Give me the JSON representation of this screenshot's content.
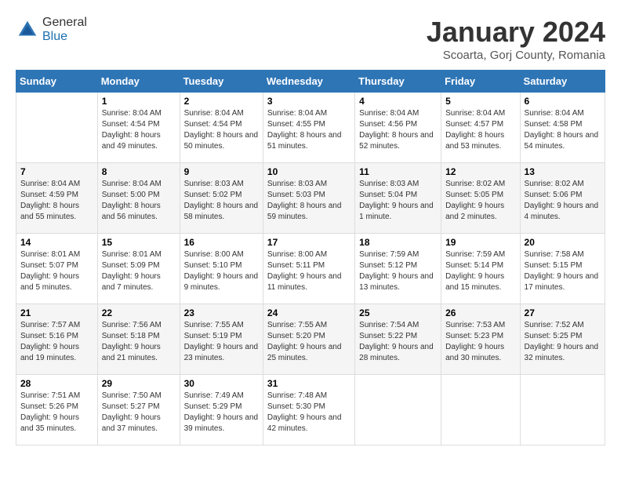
{
  "header": {
    "logo_general": "General",
    "logo_blue": "Blue",
    "month_title": "January 2024",
    "location": "Scoarta, Gorj County, Romania"
  },
  "days_of_week": [
    "Sunday",
    "Monday",
    "Tuesday",
    "Wednesday",
    "Thursday",
    "Friday",
    "Saturday"
  ],
  "weeks": [
    [
      {
        "day": "",
        "sunrise": "",
        "sunset": "",
        "daylight": ""
      },
      {
        "day": "1",
        "sunrise": "Sunrise: 8:04 AM",
        "sunset": "Sunset: 4:54 PM",
        "daylight": "Daylight: 8 hours and 49 minutes."
      },
      {
        "day": "2",
        "sunrise": "Sunrise: 8:04 AM",
        "sunset": "Sunset: 4:54 PM",
        "daylight": "Daylight: 8 hours and 50 minutes."
      },
      {
        "day": "3",
        "sunrise": "Sunrise: 8:04 AM",
        "sunset": "Sunset: 4:55 PM",
        "daylight": "Daylight: 8 hours and 51 minutes."
      },
      {
        "day": "4",
        "sunrise": "Sunrise: 8:04 AM",
        "sunset": "Sunset: 4:56 PM",
        "daylight": "Daylight: 8 hours and 52 minutes."
      },
      {
        "day": "5",
        "sunrise": "Sunrise: 8:04 AM",
        "sunset": "Sunset: 4:57 PM",
        "daylight": "Daylight: 8 hours and 53 minutes."
      },
      {
        "day": "6",
        "sunrise": "Sunrise: 8:04 AM",
        "sunset": "Sunset: 4:58 PM",
        "daylight": "Daylight: 8 hours and 54 minutes."
      }
    ],
    [
      {
        "day": "7",
        "sunrise": "Sunrise: 8:04 AM",
        "sunset": "Sunset: 4:59 PM",
        "daylight": "Daylight: 8 hours and 55 minutes."
      },
      {
        "day": "8",
        "sunrise": "Sunrise: 8:04 AM",
        "sunset": "Sunset: 5:00 PM",
        "daylight": "Daylight: 8 hours and 56 minutes."
      },
      {
        "day": "9",
        "sunrise": "Sunrise: 8:03 AM",
        "sunset": "Sunset: 5:02 PM",
        "daylight": "Daylight: 8 hours and 58 minutes."
      },
      {
        "day": "10",
        "sunrise": "Sunrise: 8:03 AM",
        "sunset": "Sunset: 5:03 PM",
        "daylight": "Daylight: 8 hours and 59 minutes."
      },
      {
        "day": "11",
        "sunrise": "Sunrise: 8:03 AM",
        "sunset": "Sunset: 5:04 PM",
        "daylight": "Daylight: 9 hours and 1 minute."
      },
      {
        "day": "12",
        "sunrise": "Sunrise: 8:02 AM",
        "sunset": "Sunset: 5:05 PM",
        "daylight": "Daylight: 9 hours and 2 minutes."
      },
      {
        "day": "13",
        "sunrise": "Sunrise: 8:02 AM",
        "sunset": "Sunset: 5:06 PM",
        "daylight": "Daylight: 9 hours and 4 minutes."
      }
    ],
    [
      {
        "day": "14",
        "sunrise": "Sunrise: 8:01 AM",
        "sunset": "Sunset: 5:07 PM",
        "daylight": "Daylight: 9 hours and 5 minutes."
      },
      {
        "day": "15",
        "sunrise": "Sunrise: 8:01 AM",
        "sunset": "Sunset: 5:09 PM",
        "daylight": "Daylight: 9 hours and 7 minutes."
      },
      {
        "day": "16",
        "sunrise": "Sunrise: 8:00 AM",
        "sunset": "Sunset: 5:10 PM",
        "daylight": "Daylight: 9 hours and 9 minutes."
      },
      {
        "day": "17",
        "sunrise": "Sunrise: 8:00 AM",
        "sunset": "Sunset: 5:11 PM",
        "daylight": "Daylight: 9 hours and 11 minutes."
      },
      {
        "day": "18",
        "sunrise": "Sunrise: 7:59 AM",
        "sunset": "Sunset: 5:12 PM",
        "daylight": "Daylight: 9 hours and 13 minutes."
      },
      {
        "day": "19",
        "sunrise": "Sunrise: 7:59 AM",
        "sunset": "Sunset: 5:14 PM",
        "daylight": "Daylight: 9 hours and 15 minutes."
      },
      {
        "day": "20",
        "sunrise": "Sunrise: 7:58 AM",
        "sunset": "Sunset: 5:15 PM",
        "daylight": "Daylight: 9 hours and 17 minutes."
      }
    ],
    [
      {
        "day": "21",
        "sunrise": "Sunrise: 7:57 AM",
        "sunset": "Sunset: 5:16 PM",
        "daylight": "Daylight: 9 hours and 19 minutes."
      },
      {
        "day": "22",
        "sunrise": "Sunrise: 7:56 AM",
        "sunset": "Sunset: 5:18 PM",
        "daylight": "Daylight: 9 hours and 21 minutes."
      },
      {
        "day": "23",
        "sunrise": "Sunrise: 7:55 AM",
        "sunset": "Sunset: 5:19 PM",
        "daylight": "Daylight: 9 hours and 23 minutes."
      },
      {
        "day": "24",
        "sunrise": "Sunrise: 7:55 AM",
        "sunset": "Sunset: 5:20 PM",
        "daylight": "Daylight: 9 hours and 25 minutes."
      },
      {
        "day": "25",
        "sunrise": "Sunrise: 7:54 AM",
        "sunset": "Sunset: 5:22 PM",
        "daylight": "Daylight: 9 hours and 28 minutes."
      },
      {
        "day": "26",
        "sunrise": "Sunrise: 7:53 AM",
        "sunset": "Sunset: 5:23 PM",
        "daylight": "Daylight: 9 hours and 30 minutes."
      },
      {
        "day": "27",
        "sunrise": "Sunrise: 7:52 AM",
        "sunset": "Sunset: 5:25 PM",
        "daylight": "Daylight: 9 hours and 32 minutes."
      }
    ],
    [
      {
        "day": "28",
        "sunrise": "Sunrise: 7:51 AM",
        "sunset": "Sunset: 5:26 PM",
        "daylight": "Daylight: 9 hours and 35 minutes."
      },
      {
        "day": "29",
        "sunrise": "Sunrise: 7:50 AM",
        "sunset": "Sunset: 5:27 PM",
        "daylight": "Daylight: 9 hours and 37 minutes."
      },
      {
        "day": "30",
        "sunrise": "Sunrise: 7:49 AM",
        "sunset": "Sunset: 5:29 PM",
        "daylight": "Daylight: 9 hours and 39 minutes."
      },
      {
        "day": "31",
        "sunrise": "Sunrise: 7:48 AM",
        "sunset": "Sunset: 5:30 PM",
        "daylight": "Daylight: 9 hours and 42 minutes."
      },
      {
        "day": "",
        "sunrise": "",
        "sunset": "",
        "daylight": ""
      },
      {
        "day": "",
        "sunrise": "",
        "sunset": "",
        "daylight": ""
      },
      {
        "day": "",
        "sunrise": "",
        "sunset": "",
        "daylight": ""
      }
    ]
  ]
}
